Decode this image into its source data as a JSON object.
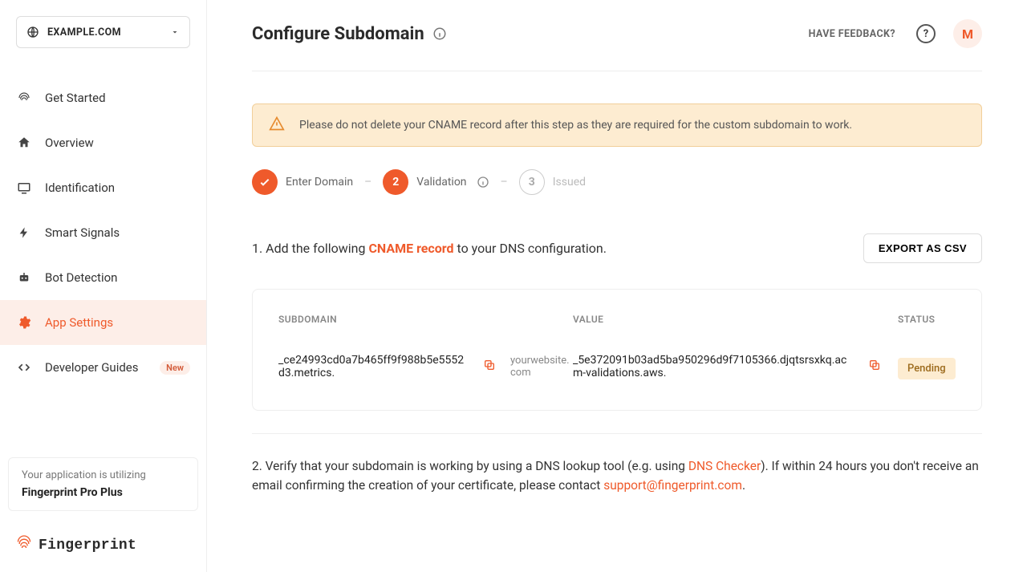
{
  "sidebar": {
    "domain": "EXAMPLE.COM",
    "items": [
      {
        "label": "Get Started",
        "icon": "fingerprint"
      },
      {
        "label": "Overview",
        "icon": "home"
      },
      {
        "label": "Identification",
        "icon": "monitor"
      },
      {
        "label": "Smart Signals",
        "icon": "bolt"
      },
      {
        "label": "Bot Detection",
        "icon": "robot"
      },
      {
        "label": "App Settings",
        "icon": "gear"
      },
      {
        "label": "Developer Guides",
        "icon": "code",
        "badge": "New"
      }
    ],
    "plan": {
      "line1": "Your application is utilizing",
      "line2": "Fingerprint Pro Plus"
    },
    "brand": "Fingerprint"
  },
  "header": {
    "title": "Configure Subdomain",
    "feedback": "HAVE FEEDBACK?",
    "avatar_initial": "M"
  },
  "alert": {
    "text": "Please do not delete your CNAME record after this step as they are required for the custom subdomain to work."
  },
  "stepper": {
    "s1": "Enter Domain",
    "s2_num": "2",
    "s2": "Validation",
    "s3_num": "3",
    "s3": "Issued",
    "sep": "–"
  },
  "section1": {
    "prefix": "1. Add the following ",
    "highlight": "CNAME record",
    "suffix": " to your DNS configuration.",
    "export_btn": "EXPORT AS CSV",
    "columns": {
      "c1": "SUBDOMAIN",
      "c2": "VALUE",
      "c3": "STATUS"
    },
    "row": {
      "subdomain_prefix": "_ce24993cd0a7b465ff9f988b5e5552d3.metrics.",
      "subdomain_domain": "yourwebsite.com",
      "value": "_5e372091b03ad5ba950296d9f7105366.djqtsrsxkq.acm-validations.aws.",
      "status": "Pending"
    }
  },
  "section2": {
    "prefix": "2. Verify that your subdomain is working by using a DNS lookup tool (e.g. using ",
    "link1": "DNS Checker",
    "mid": "). If within 24 hours you don't receive an email confirming the creation of your certificate, please contact ",
    "link2": "support@fingerprint.com",
    "suffix": "."
  }
}
